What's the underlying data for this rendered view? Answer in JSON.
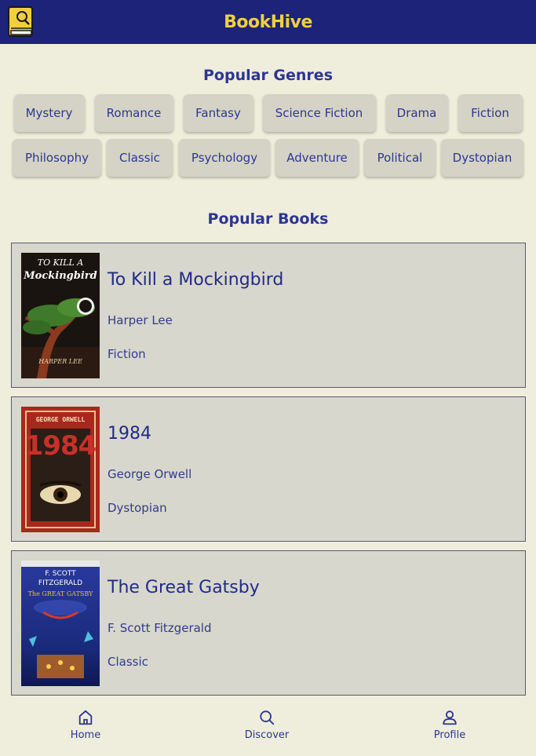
{
  "app": {
    "brand": "BookHive",
    "logo_icon": "book-icon"
  },
  "colors": {
    "header_bg": "#1c2378",
    "brand": "#f2cf3d",
    "accent": "#2d3692",
    "background": "#efeddc"
  },
  "genres_section": {
    "title": "Popular Genres",
    "rows": [
      [
        "Mystery",
        "Romance",
        "Fantasy",
        "Science Fiction",
        "Drama",
        "Fiction"
      ],
      [
        "Philosophy",
        "Classic",
        "Psychology",
        "Adventure",
        "Political",
        "Dystopian"
      ]
    ]
  },
  "books_section": {
    "title": "Popular Books",
    "books": [
      {
        "title": "To Kill a Mockingbird",
        "author": "Harper Lee",
        "genre": "Fiction",
        "cover": {
          "line1": "TO KILL A",
          "line2": "Mockingbird",
          "line3": "HARPER LEE"
        }
      },
      {
        "title": "1984",
        "author": "George Orwell",
        "genre": "Dystopian",
        "cover": {
          "line1": "GEORGE ORWELL",
          "line2": "1984"
        }
      },
      {
        "title": "The Great Gatsby",
        "author": "F. Scott Fitzgerald",
        "genre": "Classic",
        "cover": {
          "line1": "F. SCOTT",
          "line2": "FITZGERALD",
          "line3": "The GREAT GATSBY"
        }
      }
    ]
  },
  "bottom_nav": [
    {
      "label": "Home",
      "icon": "home-icon"
    },
    {
      "label": "Discover",
      "icon": "search-icon"
    },
    {
      "label": "Profile",
      "icon": "user-icon"
    }
  ]
}
